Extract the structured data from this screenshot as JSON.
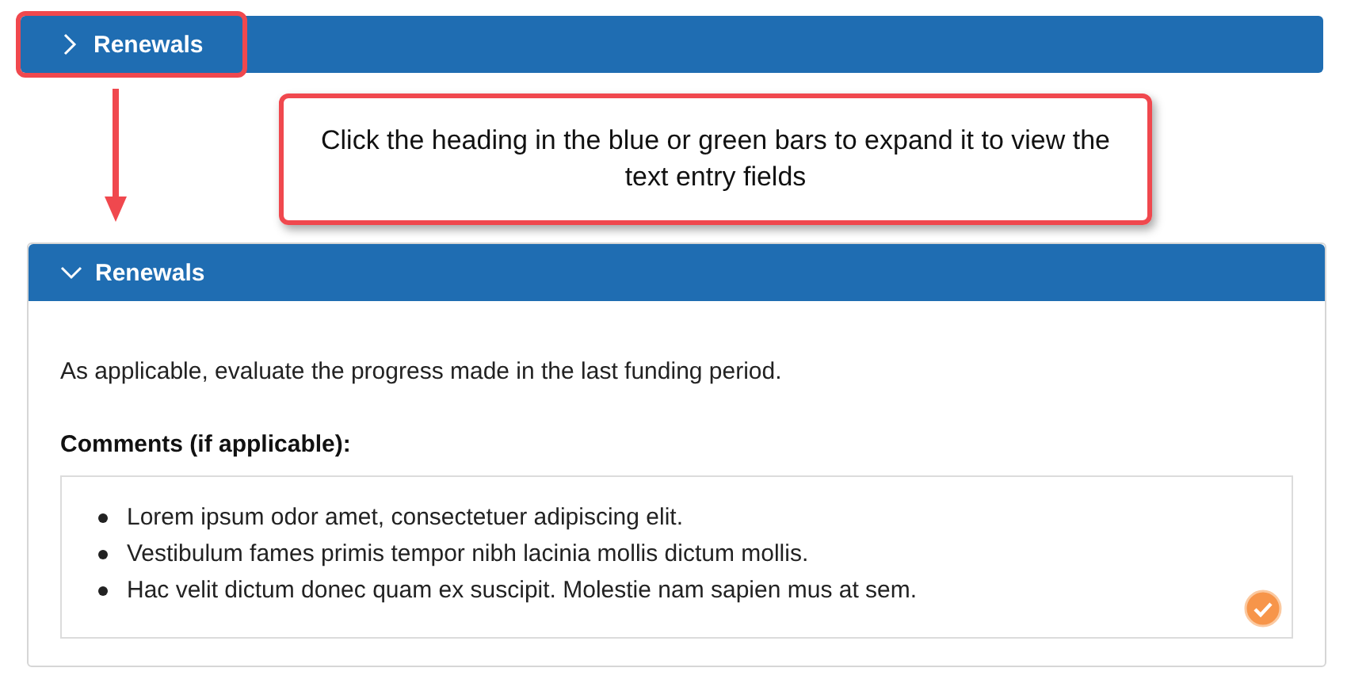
{
  "collapsed_section": {
    "title": "Renewals",
    "expanded": false,
    "highlighted": true
  },
  "callout": {
    "text": "Click the heading in the blue or green bars to expand it to view the text entry fields"
  },
  "expanded_section": {
    "title": "Renewals",
    "expanded": true,
    "prompt": "As applicable, evaluate the progress made in the last funding period.",
    "comments_label": "Comments (if applicable):",
    "comments": [
      "Lorem ipsum odor amet, consectetuer adipiscing elit.",
      "Vestibulum fames primis tempor nibh lacinia mollis dictum mollis.",
      "Hac velit dictum donec quam ex suscipit. Molestie nam sapien mus at sem."
    ],
    "checked": true
  }
}
